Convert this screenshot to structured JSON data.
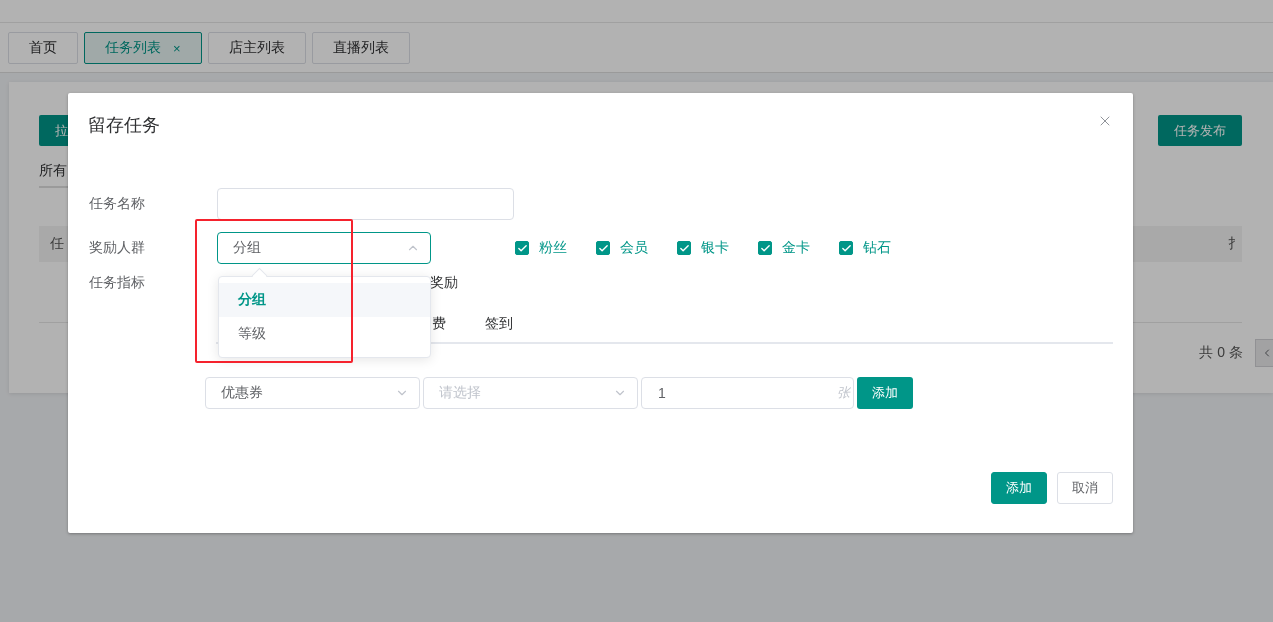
{
  "tabs": [
    {
      "label": "首页",
      "selected": false
    },
    {
      "label": "任务列表",
      "selected": true,
      "close": "×"
    },
    {
      "label": "店主列表",
      "selected": false
    },
    {
      "label": "直播列表",
      "selected": false
    }
  ],
  "page": {
    "action_button": "拉",
    "filter_label": "所有",
    "table_header": "任",
    "table_header_right": "扌",
    "total": "共 0 条",
    "publish_button": "任务发布"
  },
  "dialog": {
    "title": "留存任务",
    "name_label": "任务名称",
    "audience_label": "奖励人群",
    "audience_select": {
      "value": "分组",
      "expanded": true,
      "options": [
        {
          "label": "分组",
          "selected": true
        },
        {
          "label": "等级",
          "selected": false
        }
      ]
    },
    "audience_checkboxes": [
      {
        "label": "粉丝",
        "checked": true
      },
      {
        "label": "会员",
        "checked": true
      },
      {
        "label": "银卡",
        "checked": true
      },
      {
        "label": "金卡",
        "checked": true
      },
      {
        "label": "钻石",
        "checked": true
      }
    ],
    "metric_label": "任务指标",
    "metric_text": "奖励",
    "metric_tabs": [
      "费",
      "签到"
    ],
    "reward": {
      "type_value": "优惠券",
      "item_placeholder": "请选择",
      "quantity": "1",
      "unit": "张",
      "add_button": "添加"
    },
    "buttons": [
      {
        "label": "添加",
        "kind": "primary"
      },
      {
        "label": "取消",
        "kind": "default"
      }
    ]
  }
}
